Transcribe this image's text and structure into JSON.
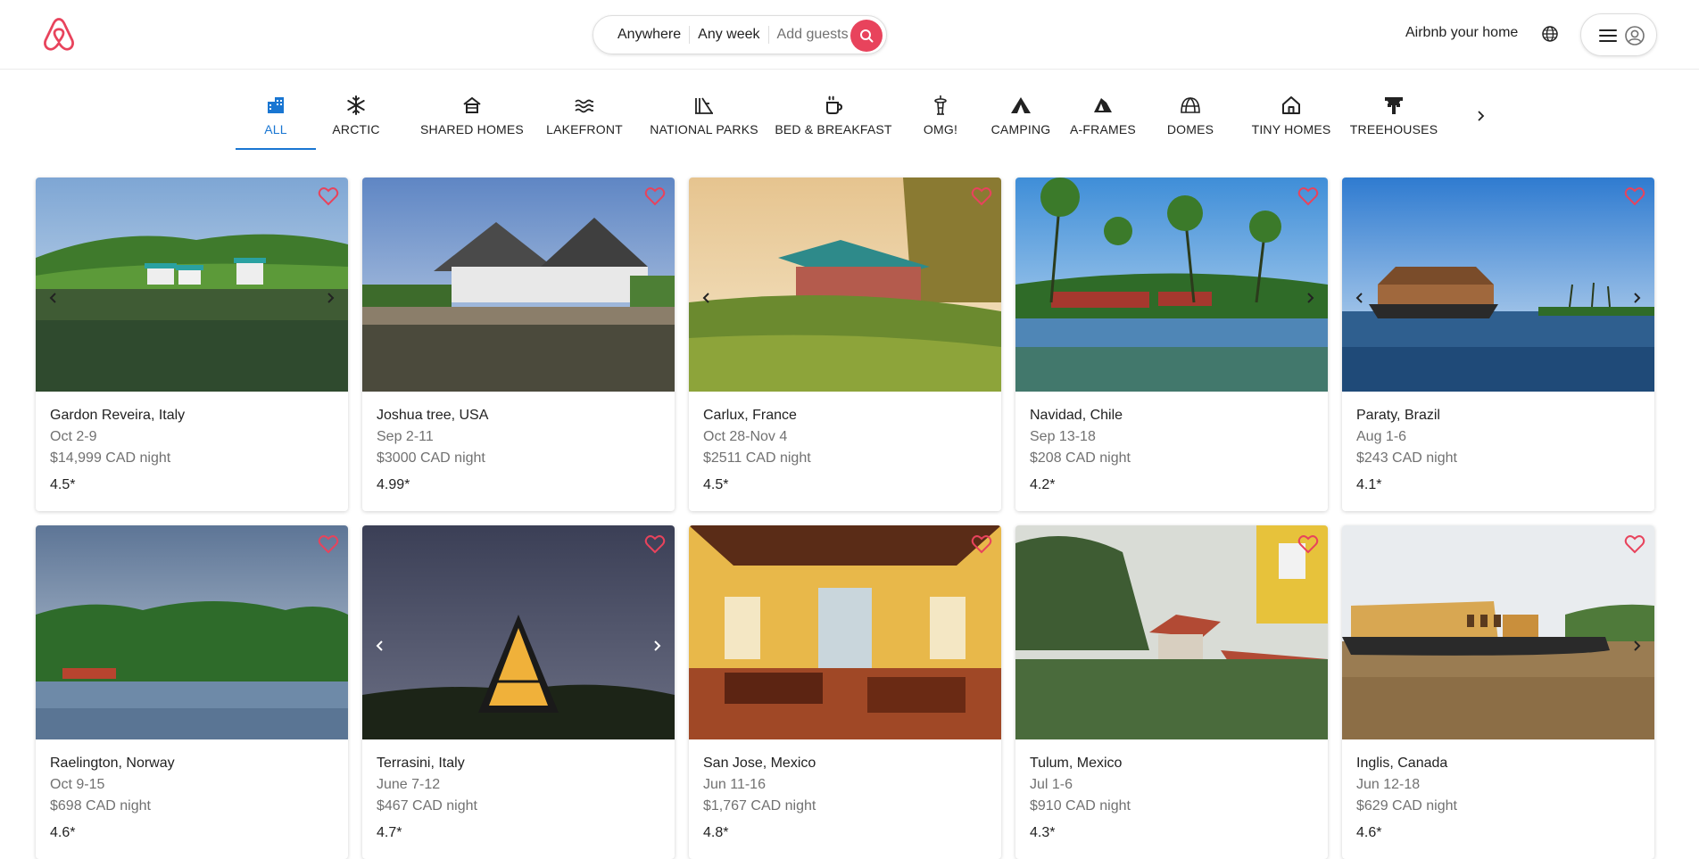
{
  "header": {
    "search": {
      "where": "Anywhere",
      "when": "Any week",
      "who": "Add guests"
    },
    "host_link": "Airbnb your home"
  },
  "categories": [
    {
      "label": "ALL",
      "icon": "buildings-icon"
    },
    {
      "label": "ARCTIC",
      "icon": "snowflake-icon"
    },
    {
      "label": "SHARED HOMES",
      "icon": "shared-home-icon"
    },
    {
      "label": "LAKEFRONT",
      "icon": "waves-icon"
    },
    {
      "label": "NATIONAL PARKS",
      "icon": "national-park-icon"
    },
    {
      "label": "BED & BREAKFAST",
      "icon": "coffee-cup-icon"
    },
    {
      "label": "OMG!",
      "icon": "space-needle-icon"
    },
    {
      "label": "CAMPING",
      "icon": "tent-icon"
    },
    {
      "label": "A-FRAMES",
      "icon": "a-frame-icon"
    },
    {
      "label": "DOMES",
      "icon": "dome-icon"
    },
    {
      "label": "TINY HOMES",
      "icon": "tiny-home-icon"
    },
    {
      "label": "TREEHOUSES",
      "icon": "treehouse-icon"
    }
  ],
  "listings": [
    {
      "place": "Gardon Reveira, Italy",
      "dates": "Oct 2-9",
      "price": "$14,999 CAD night",
      "rating": "4.5*"
    },
    {
      "place": "Joshua tree, USA",
      "dates": "Sep 2-11",
      "price": "$3000 CAD night",
      "rating": "4.99*"
    },
    {
      "place": "Carlux, France",
      "dates": "Oct 28-Nov 4",
      "price": "$2511 CAD night",
      "rating": "4.5*"
    },
    {
      "place": "Navidad, Chile",
      "dates": "Sep 13-18",
      "price": "$208 CAD night",
      "rating": "4.2*"
    },
    {
      "place": "Paraty, Brazil",
      "dates": "Aug 1-6",
      "price": "$243 CAD night",
      "rating": "4.1*"
    },
    {
      "place": "Raelington, Norway",
      "dates": "Oct 9-15",
      "price": "$698 CAD night",
      "rating": "4.6*"
    },
    {
      "place": "Terrasini, Italy",
      "dates": "June 7-12",
      "price": "$467 CAD night",
      "rating": "4.7*"
    },
    {
      "place": "San Jose, Mexico",
      "dates": "Jun 11-16",
      "price": "$1,767 CAD night",
      "rating": "4.8*"
    },
    {
      "place": "Tulum, Mexico",
      "dates": "Jul 1-6",
      "price": "$910 CAD night",
      "rating": "4.3*"
    },
    {
      "place": "Inglis, Canada",
      "dates": "Jun 12-18",
      "price": "$629 CAD night",
      "rating": "4.6*"
    }
  ],
  "colors": {
    "brand": "#e8435c",
    "active_category": "#1976d2",
    "favorite": "#e8435c"
  }
}
